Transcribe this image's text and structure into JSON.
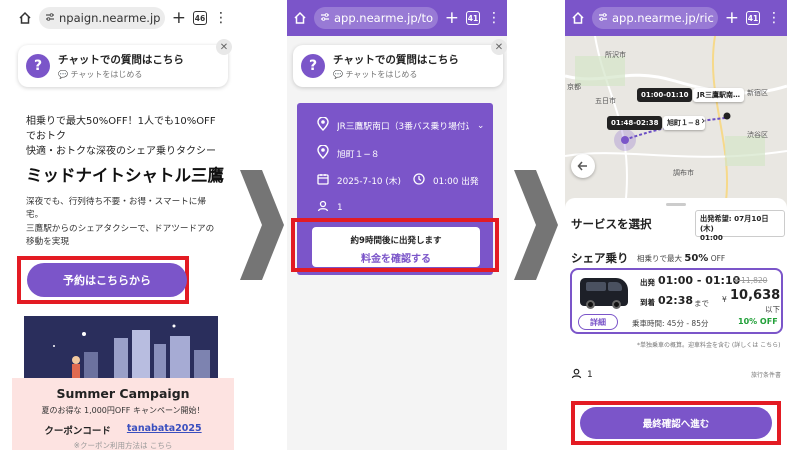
{
  "colors": {
    "accent": "#7b55c9",
    "highlight": "#e31b23",
    "discount": "#21a038",
    "campaign_bg": "#fde3e1",
    "arrow": "#757575"
  },
  "phone1": {
    "browser": {
      "url": "npaign.nearme.jp",
      "tab_count": "46"
    },
    "chat": {
      "title": "チャットでの質問はこちら",
      "subtitle": "チャットをはじめる"
    },
    "intro_lines": [
      "相乗りで最大50%OFF！1人でも10%OFF",
      "でおトク",
      "快適・おトクな深夜のシェア乗りタクシー"
    ],
    "title": "ミッドナイトシャトル三鷹",
    "desc_lines": [
      "深夜でも、行列待ち不要・お得・スマートに帰",
      "宅。",
      "三鷹駅からのシェアタクシーで、ドアツードアの",
      "移動を実現"
    ],
    "book_button": "予約はこちらから",
    "campaign": {
      "title": "Summer Campaign",
      "subtitle": "夏のお得な 1,000円OFF キャンペーン開始！",
      "code_label": "クーポンコード",
      "code": "tanabata2025",
      "cut_text": "※クーポン利用方法は こちら"
    }
  },
  "phone2": {
    "browser": {
      "url": "app.nearme.jp/to",
      "tab_count": "41"
    },
    "chat": {
      "title": "チャットでの質問はこちら",
      "subtitle": "チャットをはじめる"
    },
    "pickup": "JR三鷹駅南口（3番バス乗り場付近",
    "dropoff": "旭町１−８",
    "date": "2025-7-10 (木)",
    "time": "01:00 出発",
    "passengers": "1",
    "depart_note": "約9時間後に出発します",
    "confirm_link": "料金を確認する"
  },
  "phone3": {
    "browser": {
      "url": "app.nearme.jp/ric",
      "tab_count": "41"
    },
    "map": {
      "tag1_time": "01:00-01:10",
      "tag1_place": "JR三鷹駅南…",
      "tag2_time": "01:48-02:38",
      "tag2_place": "旭町１−８",
      "labels": [
        "所沢市",
        "京都",
        "五日市",
        "新宿区",
        "渋谷区",
        "調布市"
      ]
    },
    "select_title": "サービスを選択",
    "date_label": "出発希望: 07月10日 (木)",
    "date_time": "01:00",
    "share_title": "シェア乗り",
    "share_sub_prefix": "相乗りで最大",
    "share_sub_pct": "50%",
    "share_sub_suffix": "OFF",
    "depart_label": "出発",
    "depart_time": "01:00 - 01:10",
    "arrive_label": "到着",
    "arrive_time": "02:38",
    "arrive_suffix": "まで",
    "original_price": "¥ 11,820",
    "yen": "¥",
    "price": "10,638",
    "price_suffix": "以下",
    "discount": "10% OFF",
    "detail_button": "詳細",
    "ride_time": "乗車時間: 45分 - 85分",
    "fine_print": "*単独乗車の概算。迎車料金を含む (詳しくは こちら)",
    "passengers": "1",
    "terms": "旅行条件書",
    "next_button": "最終確認へ進む"
  }
}
